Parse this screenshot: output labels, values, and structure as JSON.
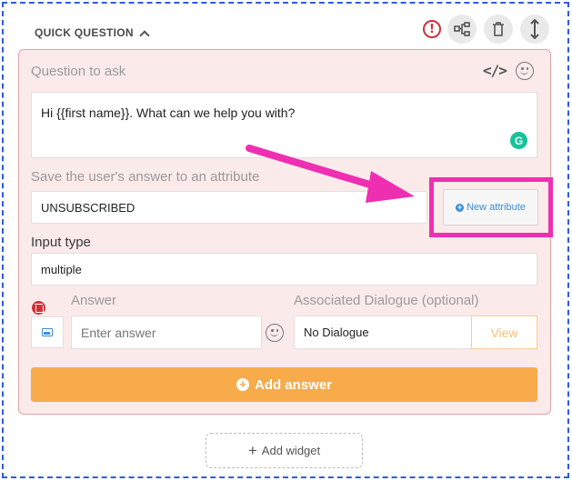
{
  "header": {
    "title": "QUICK QUESTION",
    "icons": [
      "alert-icon",
      "flow-icon",
      "trash-icon",
      "resize-icon"
    ]
  },
  "question": {
    "label": "Question to ask",
    "value": "Hi {{first name}}. What can we help you with?"
  },
  "attribute": {
    "label": "Save the user's answer to an attribute",
    "value": "UNSUBSCRIBED",
    "new_button": "New attribute"
  },
  "input_type": {
    "label": "Input type",
    "value": "multiple"
  },
  "answer": {
    "label": "Answer",
    "placeholder": "Enter answer",
    "dialogue_label": "Associated Dialogue (optional)",
    "dialogue_value": "No Dialogue",
    "view_button": "View",
    "add_button": "Add answer"
  },
  "footer": {
    "add_widget": "Add widget"
  },
  "colors": {
    "accent_orange": "#f7ab4a",
    "highlight_pink": "#ee2fb2",
    "card_bg": "#fbeaea",
    "outline_blue": "#2f5be3"
  }
}
